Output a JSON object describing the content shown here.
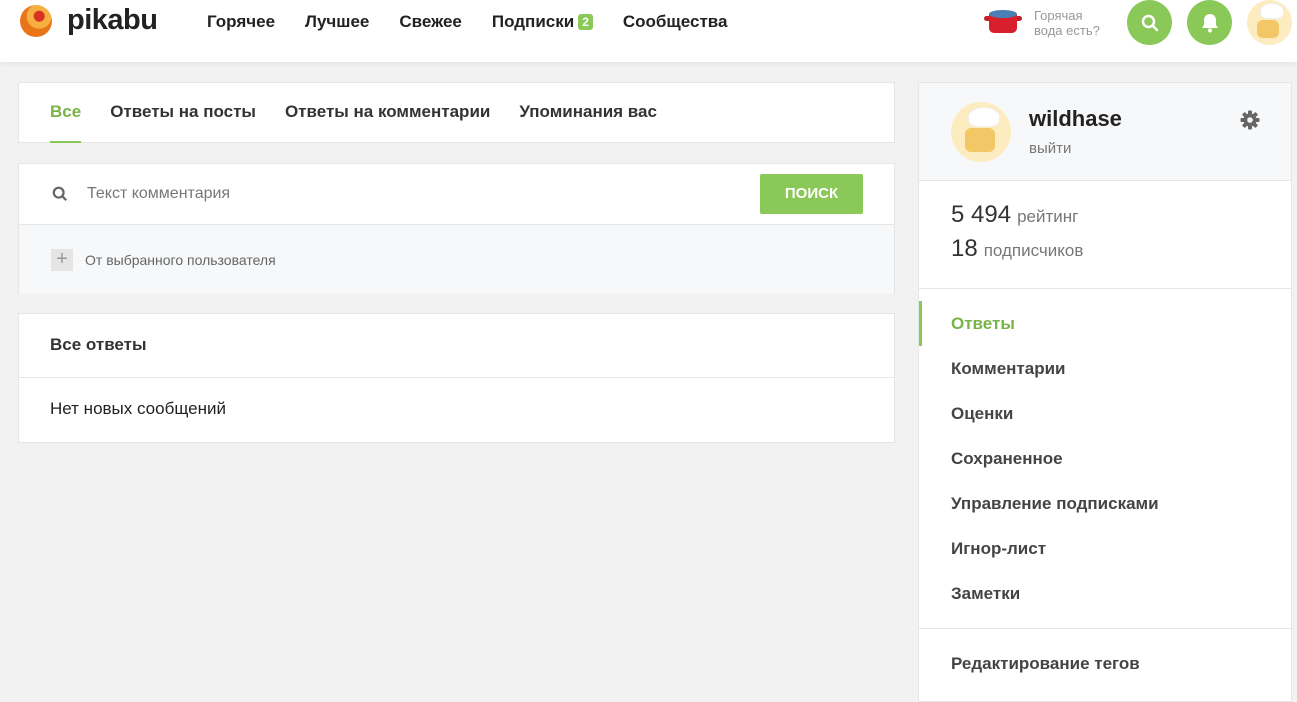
{
  "header": {
    "logo": "pikabu",
    "nav": [
      {
        "label": "Горячее"
      },
      {
        "label": "Лучшее"
      },
      {
        "label": "Свежее"
      },
      {
        "label": "Подписки",
        "badge": "2"
      },
      {
        "label": "Сообщества"
      }
    ],
    "promo": [
      "Горячая",
      "вода есть?"
    ]
  },
  "tabs": [
    "Все",
    "Ответы на посты",
    "Ответы на комментарии",
    "Упоминания вас"
  ],
  "search": {
    "placeholder": "Текст комментария",
    "button": "ПОИСК",
    "filter": "От выбранного пользователя"
  },
  "answers": {
    "title": "Все ответы",
    "empty": "Нет новых сообщений"
  },
  "sidebar": {
    "username": "wildhase",
    "logout": "выйти",
    "rating": "5 494",
    "rating_label": "рейтинг",
    "subs": "18",
    "subs_label": "подписчиков",
    "menu": [
      "Ответы",
      "Комментарии",
      "Оценки",
      "Сохраненное",
      "Управление подписками",
      "Игнор-лист",
      "Заметки"
    ],
    "tags": "Редактирование тегов"
  },
  "colors": {
    "accent": "#8ac858"
  }
}
